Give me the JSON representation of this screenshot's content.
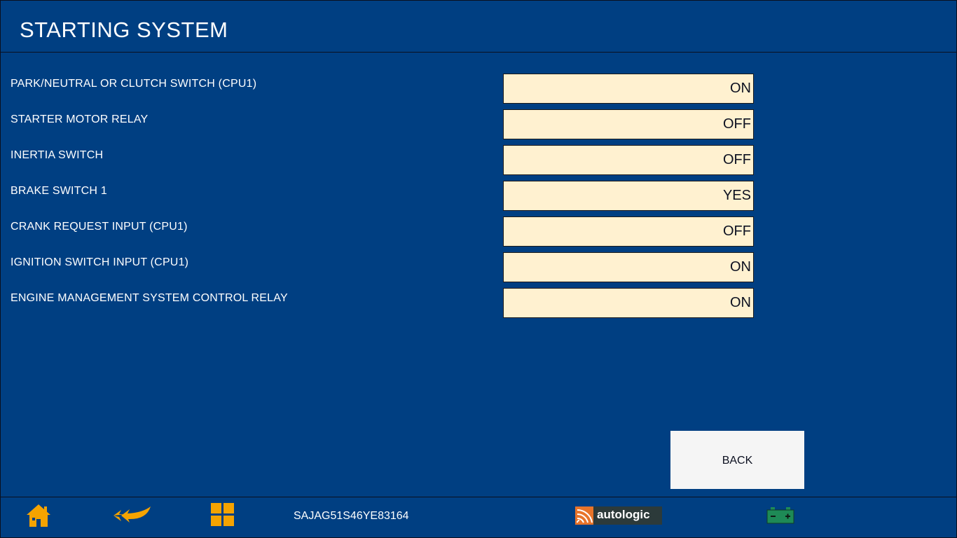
{
  "header": {
    "title": "STARTING SYSTEM"
  },
  "rows": [
    {
      "label": "PARK/NEUTRAL OR CLUTCH SWITCH (CPU1)",
      "value": "ON"
    },
    {
      "label": "STARTER MOTOR RELAY",
      "value": "OFF"
    },
    {
      "label": "INERTIA SWITCH",
      "value": "OFF"
    },
    {
      "label": "BRAKE SWITCH 1",
      "value": "YES"
    },
    {
      "label": "CRANK REQUEST INPUT (CPU1)",
      "value": "OFF"
    },
    {
      "label": "IGNITION SWITCH INPUT (CPU1)",
      "value": "ON"
    },
    {
      "label": "ENGINE MANAGEMENT SYSTEM CONTROL RELAY",
      "value": "ON"
    }
  ],
  "actions": {
    "back_label": "BACK"
  },
  "footer": {
    "vin": "SAJAG51S46YE83164",
    "logo_text": "autologic",
    "icons": {
      "home": "home-icon",
      "back": "back-arrow-icon",
      "menu": "grid-icon",
      "battery": "battery-icon"
    }
  },
  "colors": {
    "background": "#003f82",
    "value_field": "#fff1d0",
    "icon_accent": "#f5a300",
    "battery": "#1e8a56"
  }
}
